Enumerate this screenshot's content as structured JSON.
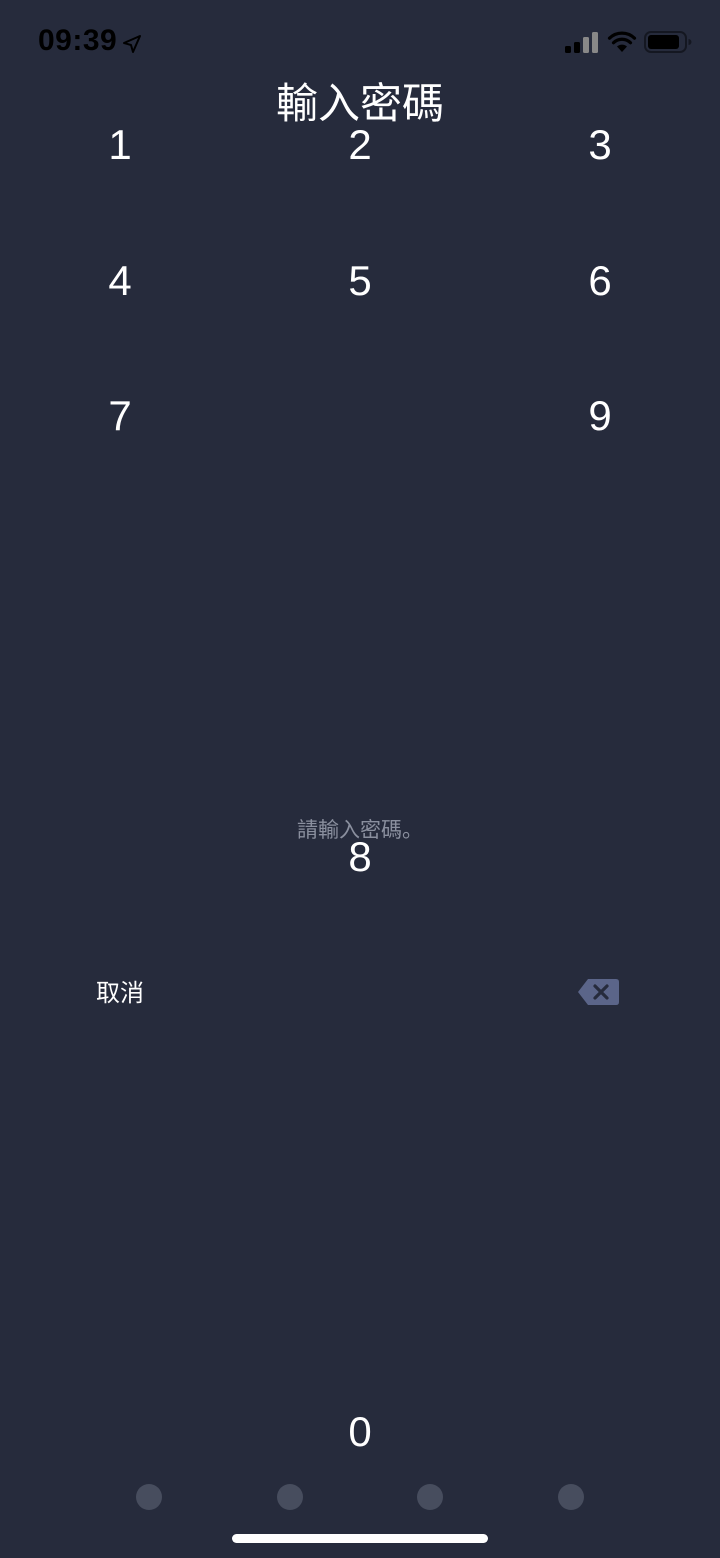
{
  "status_bar": {
    "time": "09:39",
    "icons": [
      "location-arrow-icon",
      "cellular-signal-icon",
      "wifi-icon",
      "battery-icon"
    ]
  },
  "title": "輸入密碼",
  "prompt": "請輸入密碼。",
  "keypad": {
    "k1": "1",
    "k2": "2",
    "k3": "3",
    "k4": "4",
    "k5": "5",
    "k6": "6",
    "k7": "7",
    "k8": "8",
    "k9": "9",
    "k0": "0"
  },
  "cancel_label": "取消",
  "delete_icon": "backspace-icon",
  "passcode": {
    "length": 4,
    "entered": 0
  },
  "colors": {
    "background": "#262b3c",
    "dot_empty": "#474d5e",
    "prompt_text": "#8a8f9e",
    "delete_icon": "#5b6589"
  }
}
